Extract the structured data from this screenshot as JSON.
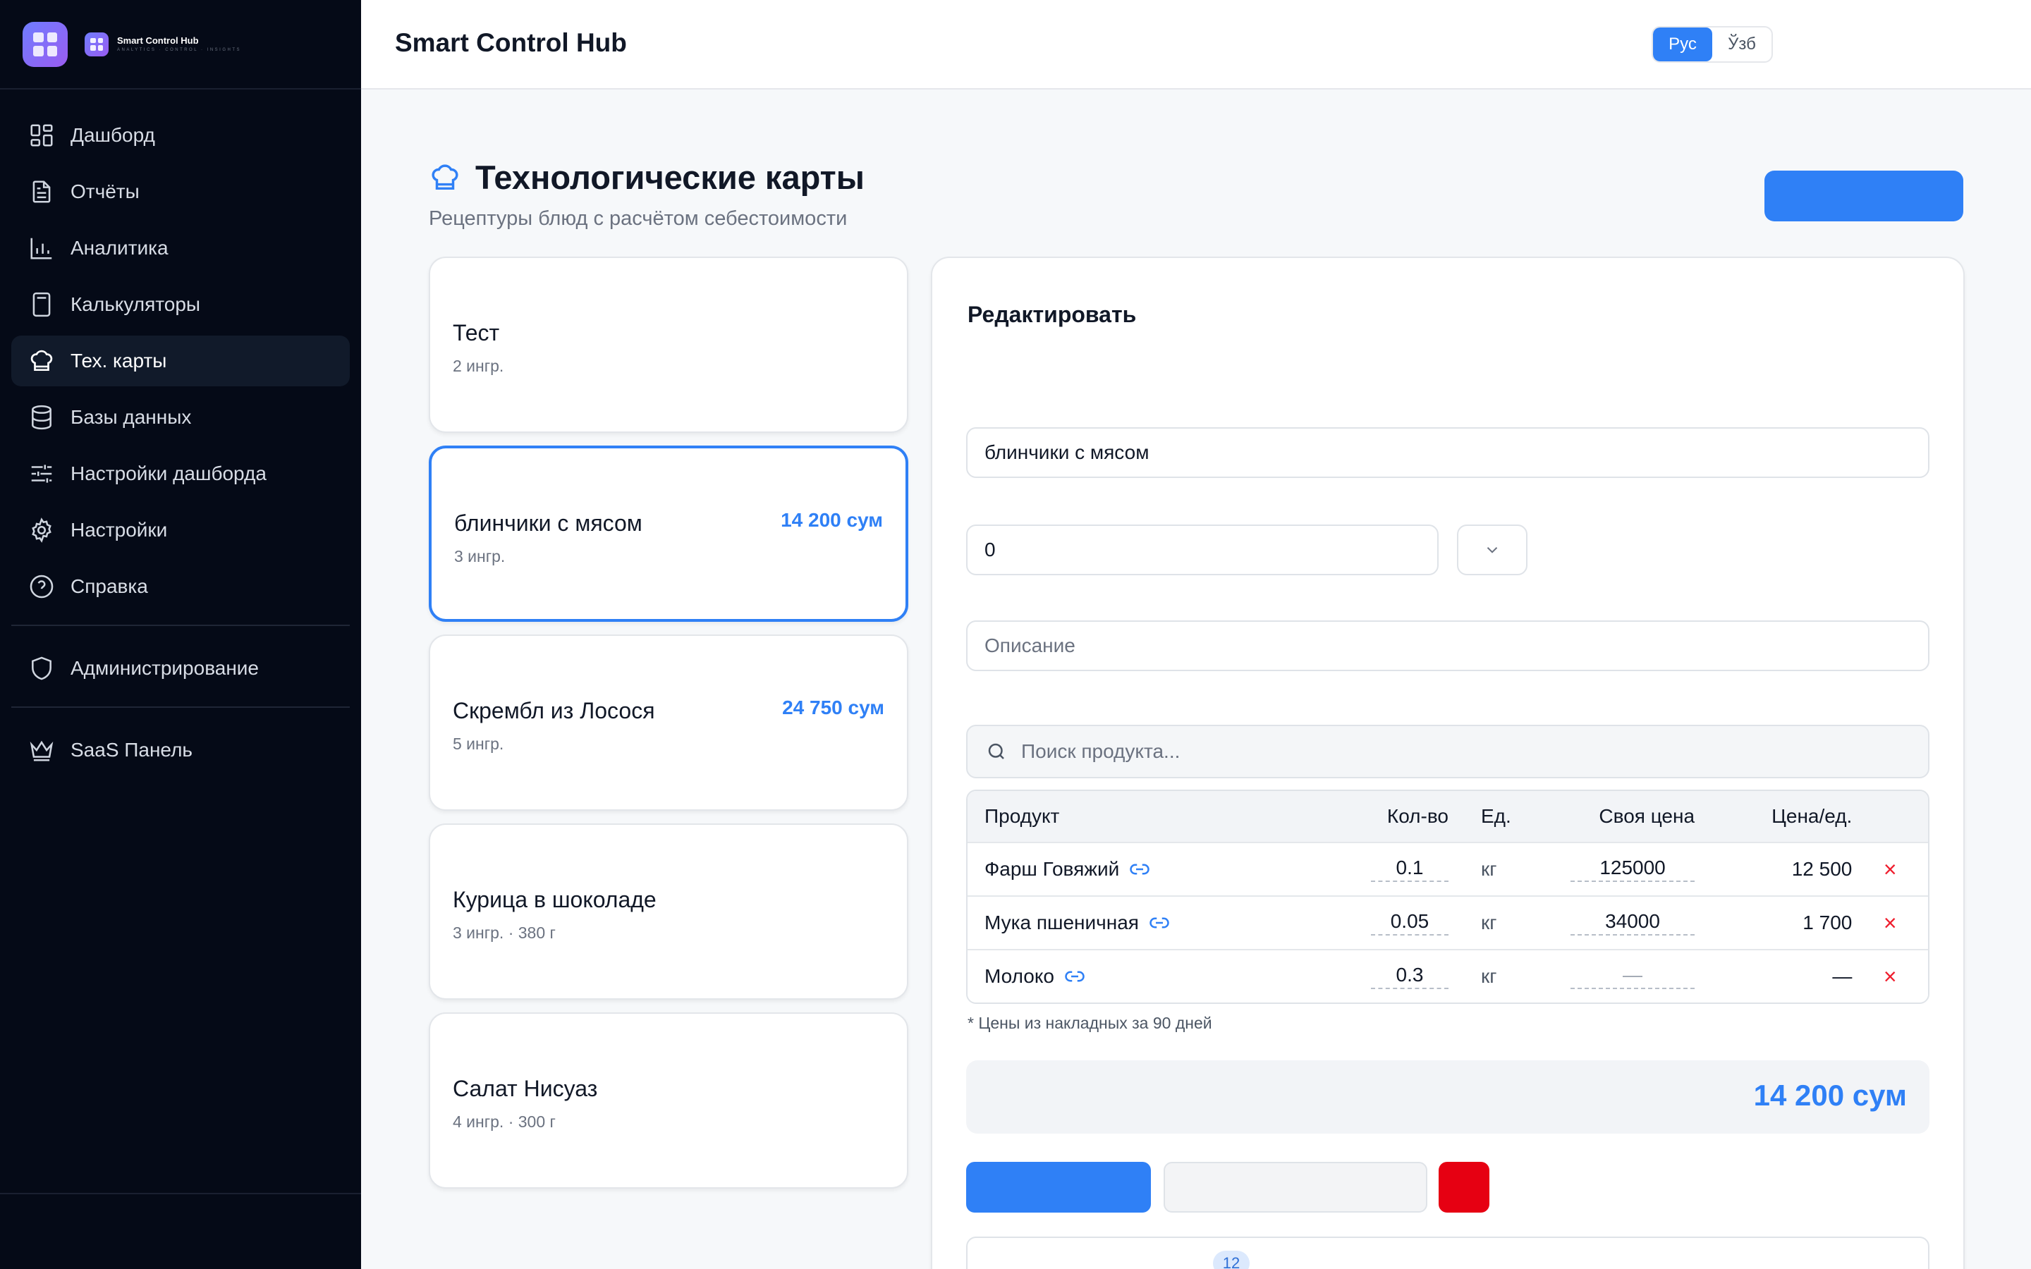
{
  "app": {
    "brand_name": "Smart Control Hub",
    "brand_tagline": "ANALYTICS · CONTROL · INSIGHTS",
    "topbar_title": "Smart Control Hub",
    "languages": [
      "Рус",
      "Ўзб"
    ],
    "active_language": "Рус",
    "accent_color": "#2f80f6"
  },
  "sidebar": {
    "items": [
      {
        "label": "Дашборд",
        "icon": "dashboard-grid-icon"
      },
      {
        "label": "Отчёты",
        "icon": "document-icon"
      },
      {
        "label": "Аналитика",
        "icon": "bar-chart-icon"
      },
      {
        "label": "Калькуляторы",
        "icon": "calculator-icon"
      },
      {
        "label": "Тех. карты",
        "icon": "chef-hat-icon",
        "active": true
      },
      {
        "label": "Базы данных",
        "icon": "database-icon"
      },
      {
        "label": "Настройки дашборда",
        "icon": "sliders-icon"
      },
      {
        "label": "Настройки",
        "icon": "gear-icon"
      },
      {
        "label": "Справка",
        "icon": "help-circle-icon"
      }
    ],
    "admin": {
      "label": "Администрирование",
      "icon": "shield-icon"
    },
    "saas": {
      "label": "SaaS Панель",
      "icon": "crown-icon"
    }
  },
  "page": {
    "title": "Технологические карты",
    "subtitle": "Рецептуры блюд с расчётом себестоимости"
  },
  "recipes": [
    {
      "name": "Тест",
      "meta": "2 ингр.",
      "price": ""
    },
    {
      "name": "блинчики с мясом",
      "meta": "3 ингр.",
      "price": "14 200 сум",
      "selected": true
    },
    {
      "name": "Скрембл из Лосося",
      "meta": "5 ингр.",
      "price": "24 750 сум"
    },
    {
      "name": "Курица в шоколаде",
      "meta": "3 ингр.   · 380 г",
      "price": ""
    },
    {
      "name": "Салат Нисуаз",
      "meta": "4 ингр.   · 300 г",
      "price": ""
    }
  ],
  "editor": {
    "title": "Редактировать",
    "name_value": "блинчики с мясом",
    "yield_value": "0",
    "description_placeholder": "Описание",
    "search_placeholder": "Поиск продукта...",
    "columns": {
      "product": "Продукт",
      "qty": "Кол-во",
      "unit": "Ед.",
      "own_price": "Своя цена",
      "unit_price": "Цена/ед."
    },
    "rows": [
      {
        "product": "Фарш Говяжий",
        "qty": "0.1",
        "unit": "кг",
        "own_price": "125000",
        "unit_price": "12 500"
      },
      {
        "product": "Мука пшеничная",
        "qty": "0.05",
        "unit": "кг",
        "own_price": "34000",
        "unit_price": "1 700"
      },
      {
        "product": "Молоко",
        "qty": "0.3",
        "unit": "кг",
        "own_price": "—",
        "unit_price": "—"
      }
    ],
    "delete_symbol": "×",
    "note": "* Цены из накладных за 90 дней",
    "total": "14 200 сум",
    "bottom_badge": "12"
  }
}
